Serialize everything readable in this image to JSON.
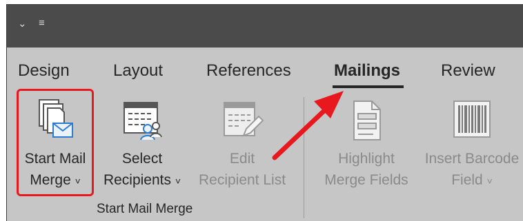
{
  "qat": {
    "icon_customize": "chevron-down-icon",
    "icon_more": "customize-qat-icon"
  },
  "tabs": [
    {
      "label": "Design"
    },
    {
      "label": "Layout"
    },
    {
      "label": "References"
    },
    {
      "label": "Mailings",
      "active": true
    },
    {
      "label": "Review"
    }
  ],
  "ribbon": {
    "start_mail_merge": {
      "line1": "Start Mail",
      "line2": "Merge",
      "dropdown": "˅"
    },
    "select_recipients": {
      "line1": "Select",
      "line2": "Recipients",
      "dropdown": "˅"
    },
    "edit_recipient_list": {
      "line1": "Edit",
      "line2": "Recipient List"
    },
    "highlight_merge_fields": {
      "line1": "Highlight",
      "line2": "Merge Fields"
    },
    "insert_barcode": {
      "line1": "Insert Barcode",
      "line2": "Field",
      "dropdown": "˅"
    },
    "group_label": "Start Mail Merge"
  },
  "colors": {
    "highlight": "#e8191e",
    "titlebar": "#4b4b4b",
    "ribbon": "#c6c6c6"
  }
}
